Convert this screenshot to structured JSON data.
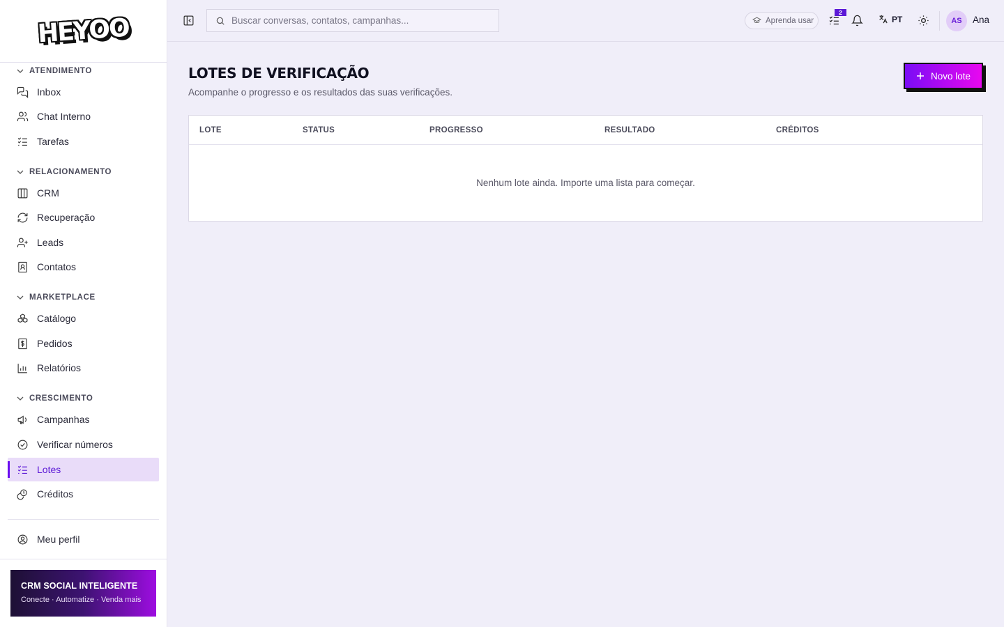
{
  "brand": {
    "logo_text": "HEYOO"
  },
  "sidebar": {
    "sections": [
      {
        "title": "ATENDIMENTO"
      },
      {
        "title": "RELACIONAMENTO"
      },
      {
        "title": "MARKETPLACE"
      },
      {
        "title": "CRESCIMENTO"
      }
    ],
    "items": [
      {
        "label": "Inbox",
        "icon": "chat-bubbles-icon"
      },
      {
        "label": "Chat Interno",
        "icon": "users-icon"
      },
      {
        "label": "Tarefas",
        "icon": "list-checks-icon"
      },
      {
        "label": "CRM",
        "icon": "columns-icon"
      },
      {
        "label": "Recuperação",
        "icon": "refresh-icon"
      },
      {
        "label": "Leads",
        "icon": "user-plus-icon"
      },
      {
        "label": "Contatos",
        "icon": "contact-book-icon"
      },
      {
        "label": "Catálogo",
        "icon": "boxes-icon"
      },
      {
        "label": "Pedidos",
        "icon": "receipt-dollar-icon"
      },
      {
        "label": "Relatórios",
        "icon": "bar-chart-icon"
      },
      {
        "label": "Campanhas",
        "icon": "megaphone-icon"
      },
      {
        "label": "Verificar números",
        "icon": "check-circle-icon"
      },
      {
        "label": "Lotes",
        "icon": "list-checks-icon",
        "active": true
      },
      {
        "label": "Créditos",
        "icon": "coins-icon"
      },
      {
        "label": "Meu perfil",
        "icon": "user-circle-icon"
      }
    ],
    "promo": {
      "title": "CRM SOCIAL INTELIGENTE",
      "subtitle": "Conecte · Automatize · Venda mais"
    }
  },
  "header": {
    "search_placeholder": "Buscar conversas, contatos, campanhas...",
    "learn_label": "Aprenda usar",
    "tasks_badge": "2",
    "language": "PT",
    "user_initials": "AS",
    "user_name": "Ana"
  },
  "main": {
    "title": "LOTES DE VERIFICAÇÃO",
    "subtitle": "Acompanhe o progresso e os resultados das suas verificações.",
    "new_button_label": "Novo lote",
    "table": {
      "columns": [
        "LOTE",
        "STATUS",
        "PROGRESSO",
        "RESULTADO",
        "CRÉDITOS"
      ],
      "empty_message": "Nenhum lote ainda. Importe uma lista para começar."
    }
  },
  "colors": {
    "accent": "#6a0df0",
    "accent_gradient_end": "#e808ef",
    "active_bg": "#e9dcf9",
    "page_bg": "#f0eef9"
  }
}
